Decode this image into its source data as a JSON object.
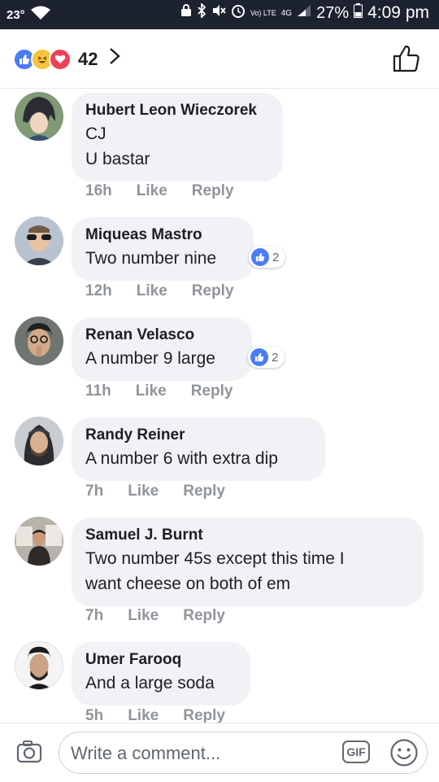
{
  "status_bar": {
    "temperature": "23°",
    "network_label": "Vo) LTE",
    "signal_label": "4G",
    "battery": "27%",
    "time": "4:09 pm"
  },
  "header": {
    "reaction_icons": [
      "like-icon",
      "haha-icon",
      "love-icon"
    ],
    "reaction_count": "42",
    "chevron": "›"
  },
  "comments": [
    {
      "name": "Hubert Leon Wieczorek",
      "text": "CJ\nU bastar",
      "time": "16h",
      "like_label": "Like",
      "reply_label": "Reply",
      "reactions": null
    },
    {
      "name": "Miqueas Mastro",
      "text": "Two number nine",
      "time": "12h",
      "like_label": "Like",
      "reply_label": "Reply",
      "reactions": "2"
    },
    {
      "name": "Renan Velasco",
      "text": "A number 9 large",
      "time": "11h",
      "like_label": "Like",
      "reply_label": "Reply",
      "reactions": "2"
    },
    {
      "name": "Randy Reiner",
      "text": "A number 6 with extra dip",
      "time": "7h",
      "like_label": "Like",
      "reply_label": "Reply",
      "reactions": null
    },
    {
      "name": "Samuel J. Burnt",
      "text": "Two number 45s except this time I\nwant cheese on both of em",
      "time": "7h",
      "like_label": "Like",
      "reply_label": "Reply",
      "reactions": null
    },
    {
      "name": "Umer Farooq",
      "text": "And a large soda",
      "time": "5h",
      "like_label": "Like",
      "reply_label": "Reply",
      "reactions": null
    }
  ],
  "composer": {
    "placeholder": "Write a comment...",
    "gif_label": "GIF"
  },
  "colors": {
    "like_blue": "#4a7cf5",
    "haha_yellow": "#f7c33c",
    "love_red": "#f04058",
    "bubble_bg": "#f0f2f5",
    "meta_gray": "#90949c"
  }
}
